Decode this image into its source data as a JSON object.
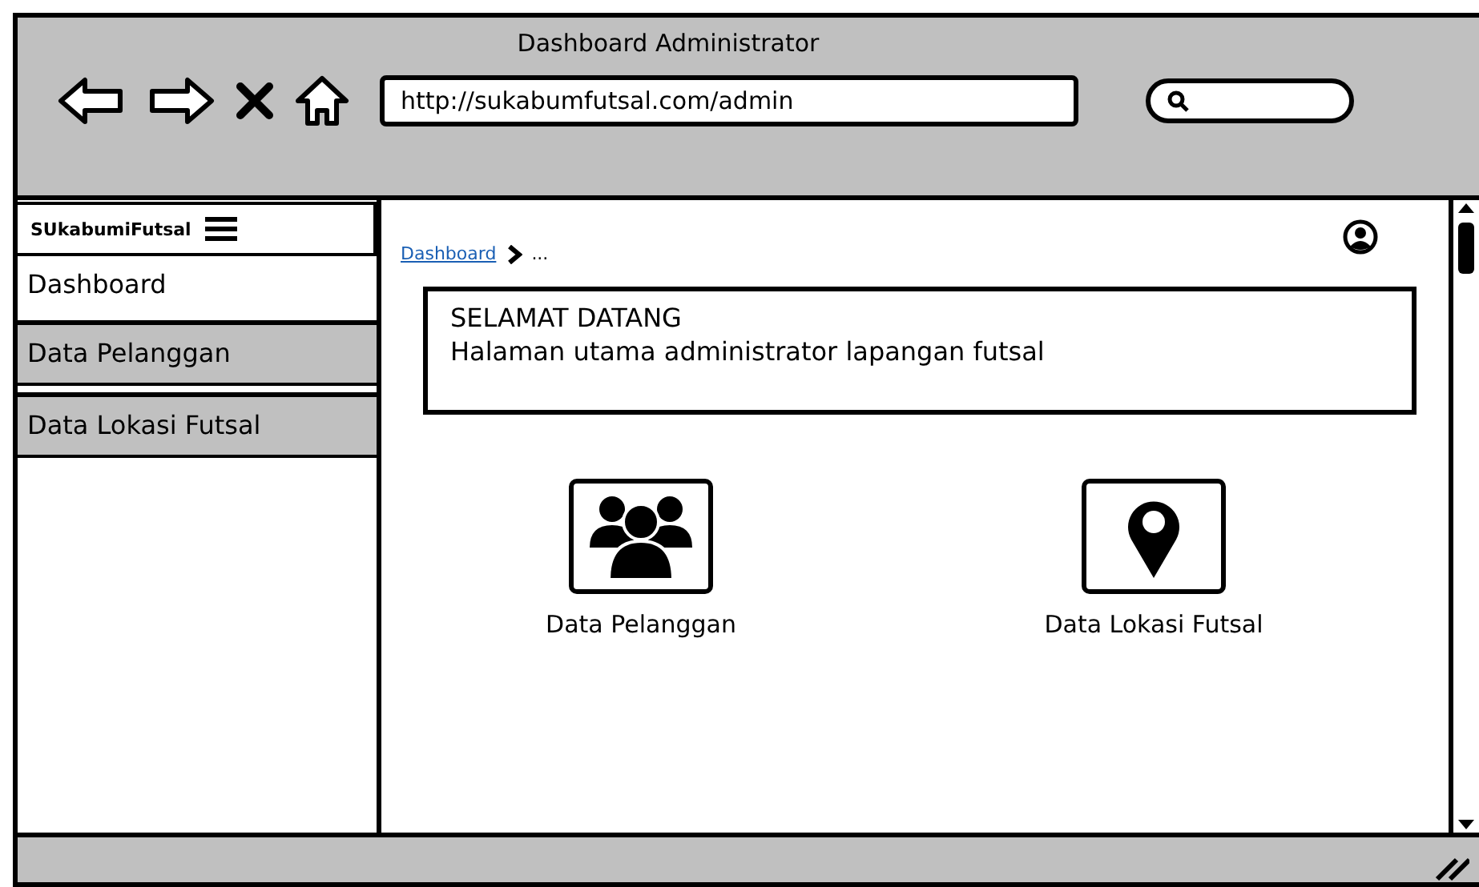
{
  "window": {
    "title": "Dashboard Administrator"
  },
  "address_bar": {
    "value": "http://sukabumfutsal.com/admin"
  },
  "sidebar": {
    "brand": "SUkabumiFutsal",
    "items": [
      {
        "label": "Dashboard",
        "selected": true
      },
      {
        "label": "Data Pelanggan",
        "selected": false
      },
      {
        "label": "Data Lokasi Futsal",
        "selected": false
      }
    ]
  },
  "breadcrumb": {
    "link": "Dashboard",
    "current": "..."
  },
  "welcome": {
    "title": "SELAMAT DATANG",
    "text": "Halaman utama administrator lapangan futsal"
  },
  "tiles": [
    {
      "kind": "people",
      "label": "Data Pelanggan"
    },
    {
      "kind": "pin",
      "label": "Data Lokasi Futsal"
    }
  ]
}
